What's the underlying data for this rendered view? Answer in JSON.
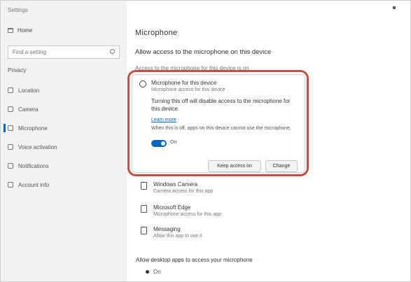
{
  "window": {
    "title": "Settings"
  },
  "sidebar": {
    "home_label": "Home",
    "search_placeholder": "Find a setting",
    "section_label": "Privacy",
    "items": [
      {
        "label": "Location",
        "icon": "location-icon"
      },
      {
        "label": "Camera",
        "icon": "camera-icon"
      },
      {
        "label": "Microphone",
        "icon": "microphone-icon",
        "selected": true
      },
      {
        "label": "Voice activation",
        "icon": "voice-icon"
      },
      {
        "label": "Notifications",
        "icon": "notifications-icon"
      },
      {
        "label": "Account info",
        "icon": "account-icon"
      }
    ]
  },
  "main": {
    "page_title": "Microphone",
    "subhead": "Allow access to the microphone on this device",
    "faded_line": "Access to the microphone for this device is on"
  },
  "dialog": {
    "title": "Microphone for this device",
    "subtitle": "Microphone access for this device",
    "description": "Turning this off will disable access to the microphone for this device.",
    "link": "Learn more",
    "note": "When this is off, apps on this device cannot use the microphone.",
    "toggle_label": "On",
    "toggle_on": true,
    "primary_button": "Keep access on",
    "secondary_button": "Change"
  },
  "downloads": [
    {
      "title": "Windows Camera",
      "subtitle": "Camera access for this app",
      "icon": "app-icon"
    },
    {
      "title": "Microsoft Edge",
      "subtitle": "Microphone access for this app",
      "icon": "app-icon"
    },
    {
      "title": "Messaging",
      "subtitle": "Allow this app to use it",
      "icon": "app-icon"
    }
  ],
  "footer": {
    "question": "Allow desktop apps to access your microphone",
    "option": "On"
  },
  "colors": {
    "accent": "#0067c0",
    "highlight": "#c65140"
  }
}
